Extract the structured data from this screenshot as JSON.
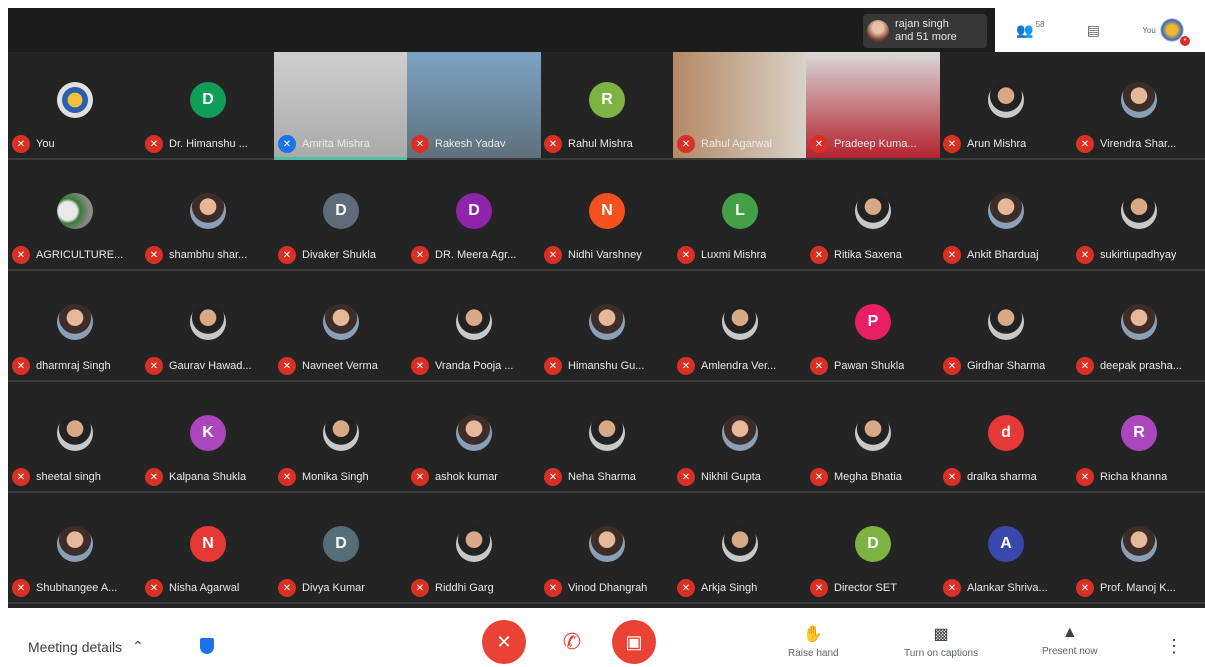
{
  "presenter": {
    "name": "rajan singh",
    "more": "and 51 more"
  },
  "top_icons": {
    "participants_count": "58",
    "self_label": "You"
  },
  "participants": [
    [
      "You",
      "Dr. Himanshu ...",
      "Amrita Mishra",
      "Rakesh Yadav",
      "Rahul Mishra",
      "Rahul Agarwal",
      "Pradeep Kuma...",
      "Arun Mishra",
      "Virendra Shar..."
    ],
    [
      "AGRICULTURE...",
      "shambhu shar...",
      "Divaker Shukla",
      "DR. Meera Agr...",
      "Nidhi Varshney",
      "Luxmi Mishra",
      "Ritika Saxena",
      "Ankit Bharduaj",
      "sukirtiupadhyay"
    ],
    [
      "dharmraj Singh",
      "Gaurav Hawad...",
      "Navneet Verma",
      "Vrandа Pooja ...",
      "Himanshu Gu...",
      "Amlendra Ver...",
      "Pawan Shukla",
      "Girdhar Sharma",
      "deepak prasha..."
    ],
    [
      "sheetal singh",
      "Kalpana Shukla",
      "Monika Singh",
      "ashok kumar",
      "Neha Sharma",
      "Nikhil Gupta",
      "Megha Bhatia",
      "dralka sharma",
      "Richa khanna"
    ],
    [
      "Shubhangee A...",
      "Nisha Agarwal",
      "Divya Kumar",
      "Riddhi Garg",
      "Vinod Dhangrah",
      "Arkja Singh",
      "Director SET",
      "Alankar Shriva...",
      "Prof. Manoj K..."
    ]
  ],
  "avatars": [
    [
      {
        "t": "emblem"
      },
      {
        "l": "D",
        "c": "#0f9d58"
      },
      {
        "t": "video"
      },
      {
        "t": "video"
      },
      {
        "l": "R",
        "c": "#7cb342"
      },
      {
        "t": "video"
      },
      {
        "t": "video"
      },
      {
        "t": "photo"
      },
      {
        "t": "photo"
      }
    ],
    [
      {
        "t": "group"
      },
      {
        "t": "photo"
      },
      {
        "l": "D",
        "c": "#5f6b7a"
      },
      {
        "l": "D",
        "c": "#8e24aa"
      },
      {
        "l": "N",
        "c": "#f4511e"
      },
      {
        "l": "L",
        "c": "#43a047"
      },
      {
        "t": "photo"
      },
      {
        "t": "photo"
      },
      {
        "t": "photo"
      }
    ],
    [
      {
        "t": "photo"
      },
      {
        "t": "photo"
      },
      {
        "t": "photo"
      },
      {
        "t": "photo"
      },
      {
        "t": "photo"
      },
      {
        "t": "photo"
      },
      {
        "l": "P",
        "c": "#e91e63"
      },
      {
        "t": "photo"
      },
      {
        "t": "photo"
      }
    ],
    [
      {
        "t": "photo"
      },
      {
        "l": "K",
        "c": "#ab47bc"
      },
      {
        "t": "photo"
      },
      {
        "t": "photo"
      },
      {
        "t": "photo"
      },
      {
        "t": "photo"
      },
      {
        "t": "photo"
      },
      {
        "l": "d",
        "c": "#e53935"
      },
      {
        "l": "R",
        "c": "#ab47bc"
      }
    ],
    [
      {
        "t": "photo"
      },
      {
        "l": "N",
        "c": "#e53935"
      },
      {
        "l": "D",
        "c": "#546e7a"
      },
      {
        "t": "photo"
      },
      {
        "t": "photo"
      },
      {
        "t": "photo"
      },
      {
        "l": "D",
        "c": "#7cb342"
      },
      {
        "l": "A",
        "c": "#3949ab"
      },
      {
        "t": "photo"
      }
    ]
  ],
  "bottom": {
    "meeting_details": "Meeting details",
    "raise_hand": "Raise hand",
    "captions": "Turn on captions",
    "present": "Present now"
  },
  "colors": {
    "mic_off": "#d93025",
    "end_call": "#ea4335",
    "speaking": "#4fc3a1"
  }
}
